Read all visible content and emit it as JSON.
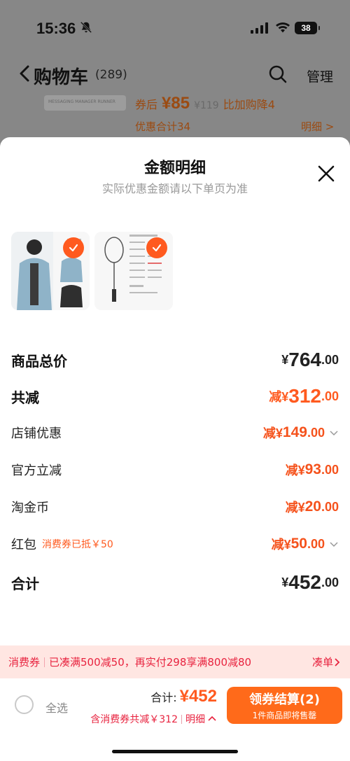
{
  "status_bar": {
    "time": "15:36",
    "battery": "38"
  },
  "background": {
    "title": "购物车",
    "count": "(289)",
    "manage": "管理",
    "thumb_text": "MESSAGING MANAGER RUNNER",
    "price_prefix": "券后",
    "price": "¥85",
    "original_price": "¥119",
    "promo": "比加购降4",
    "discount_total": "优惠合计34",
    "detail": "明细 >"
  },
  "sheet": {
    "title": "金额明细",
    "subtitle": "实际优惠金额请以下单页为准",
    "products": [
      {
        "name": "jacket-thumbnail"
      },
      {
        "name": "racket-thumbnail"
      }
    ],
    "rows": {
      "subtotal": {
        "label": "商品总价",
        "prefix": "¥",
        "int": "764",
        "dec": ".00"
      },
      "total_discount": {
        "label": "共减",
        "prefix": "减¥",
        "int": "312",
        "dec": ".00"
      },
      "store": {
        "label": "店铺优惠",
        "prefix": "减¥",
        "int": "149",
        "dec": ".00"
      },
      "official": {
        "label": "官方立减",
        "prefix": "减¥",
        "int": "93",
        "dec": ".00"
      },
      "coins": {
        "label": "淘金币",
        "prefix": "减¥",
        "int": "20",
        "dec": ".00"
      },
      "redpacket": {
        "label": "红包",
        "note": "消费券已抵￥50",
        "prefix": "减¥",
        "int": "50",
        "dec": ".00"
      },
      "total": {
        "label": "合计",
        "prefix": "¥",
        "int": "452",
        "dec": ".00"
      }
    }
  },
  "banner": {
    "tag": "消费券",
    "text": "已凑满500减50，再实付298享满800减80",
    "action": "凑单"
  },
  "bottom": {
    "select_all": "全选",
    "total_label": "合计:",
    "total_value": "¥452",
    "saving": "含消费券共减￥312",
    "detail": "明细",
    "checkout_main": "领券结算(2)",
    "checkout_sub": "1件商品即将售罄"
  },
  "colors": {
    "accent": "#ff5a1f",
    "red": "#e8233f",
    "banner_bg": "#ffe6e2"
  }
}
